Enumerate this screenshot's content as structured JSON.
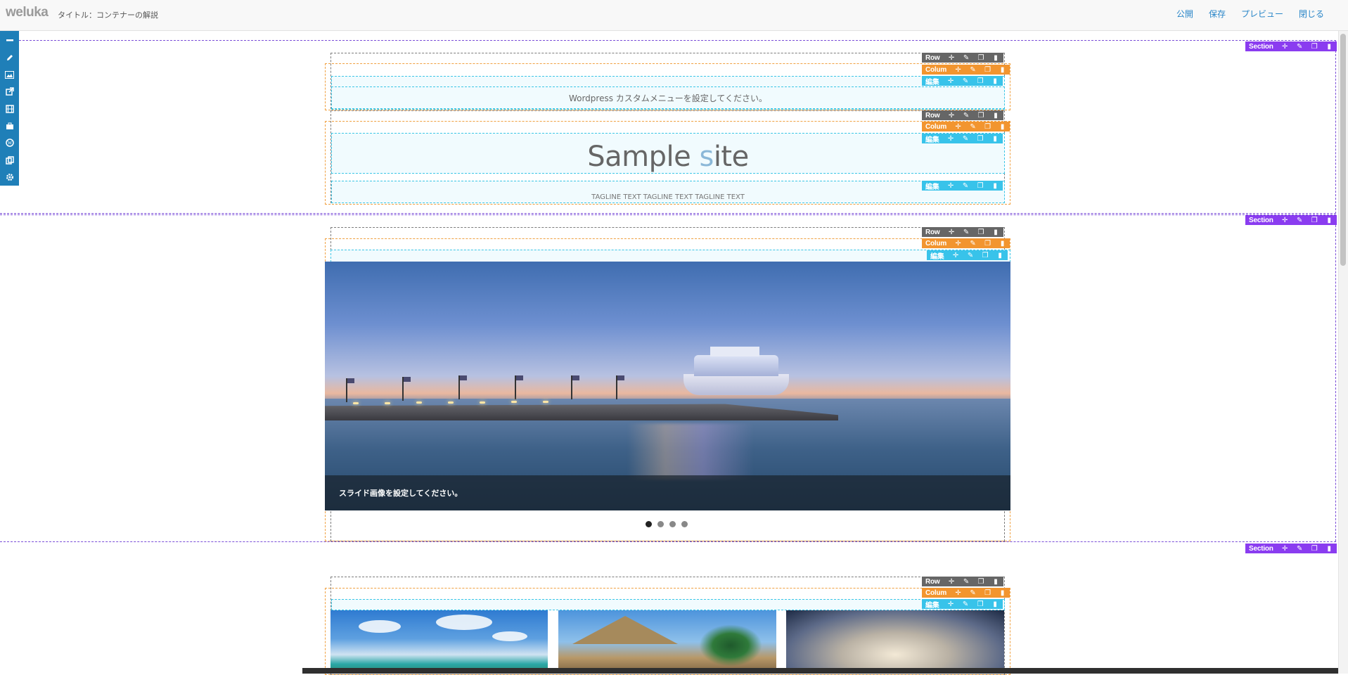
{
  "app": {
    "logo": "weluka",
    "page_title": "タイトル：コンテナーの解説",
    "actions": [
      "公開",
      "保存",
      "プレビュー",
      "閉じる"
    ]
  },
  "tools": [
    "minus-icon",
    "pencil-icon",
    "image-icon",
    "external-link-icon",
    "film-icon",
    "briefcase-icon",
    "wordpress-icon",
    "copy-icon",
    "gear-icon"
  ],
  "controls": {
    "section": "Section",
    "row": "Row",
    "column": "Colum",
    "element": "編集"
  },
  "header_section": {
    "menu_text": "Wordpress カスタムメニューを設定してください。",
    "site_title_part1": "Sample ",
    "site_title_highlight": "s",
    "site_title_part2": "ite",
    "tagline": "TAGLINE TEXT TAGLINE TEXT TAGLINE TEXT"
  },
  "slider_section": {
    "caption": "スライド画像を設定してください。",
    "slide_count": 4,
    "active_slide": 1
  },
  "gallery_section": {
    "thumbnails": [
      "beach-image",
      "hut-image",
      "interior-image"
    ]
  },
  "colors": {
    "section": "#8a3cf0",
    "row": "#666666",
    "column": "#f2952f",
    "element": "#38c3ea",
    "toolbar": "#1f7fb8",
    "link": "#2a86c8"
  }
}
